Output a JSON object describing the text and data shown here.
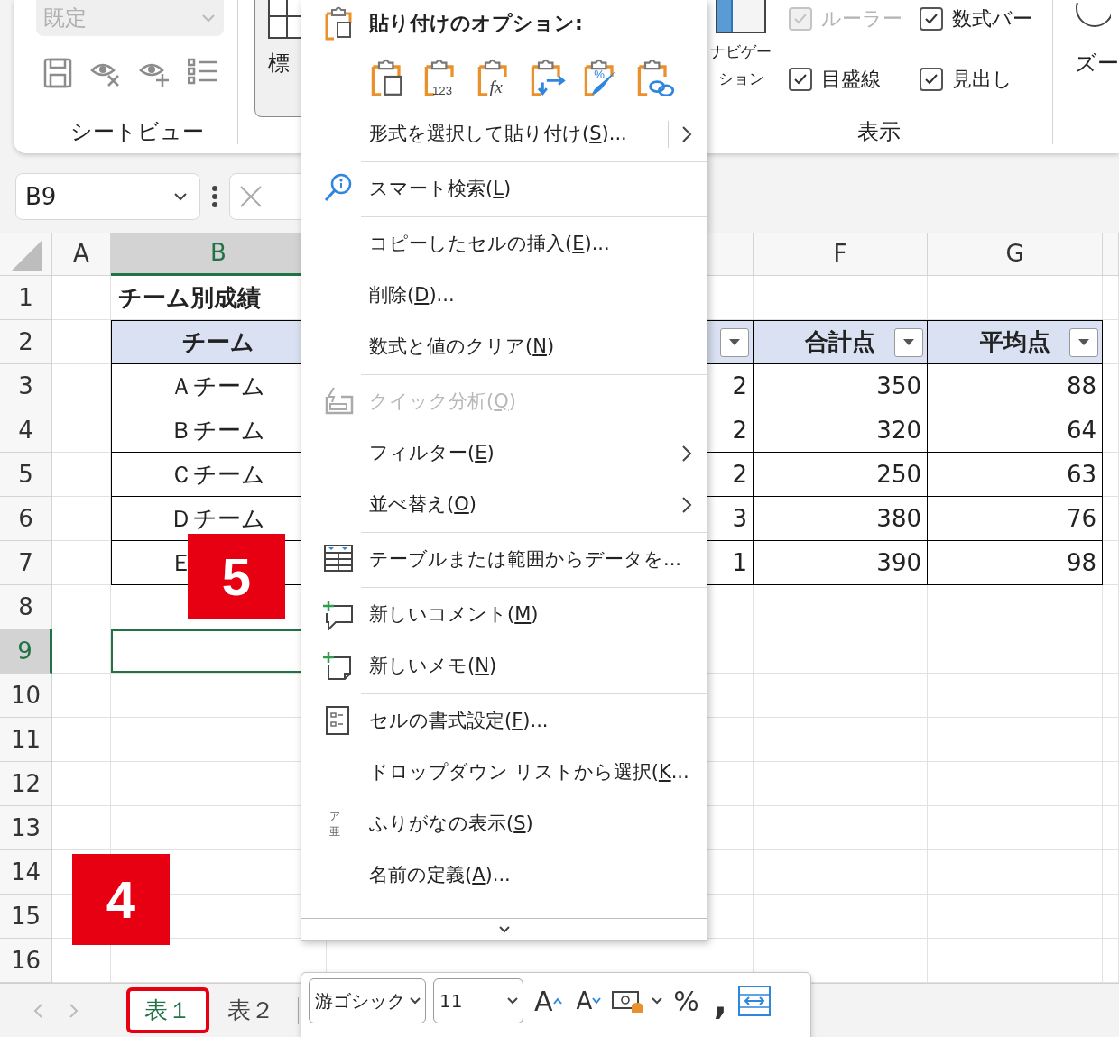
{
  "ribbon": {
    "sheet_view": {
      "dropdown": {
        "value": "既定",
        "disabled": true
      },
      "label": "シートビュー"
    },
    "normal_button": {
      "label": "標"
    },
    "show": {
      "navigation_label": "ナビゲーション",
      "checkboxes": [
        {
          "label": "ルーラー",
          "checked": true,
          "disabled": true
        },
        {
          "label": "数式バー",
          "checked": true,
          "disabled": false
        },
        {
          "label": "目盛線",
          "checked": true,
          "disabled": false
        },
        {
          "label": "見出し",
          "checked": true,
          "disabled": false
        }
      ],
      "label": "表示"
    },
    "zoom": {
      "label": "ズー"
    }
  },
  "formula_bar": {
    "name_box": "B9"
  },
  "sheet": {
    "columns": {
      "A": {
        "label": "A",
        "selected": false
      },
      "B": {
        "label": "B",
        "selected": true
      },
      "F": {
        "label": "F",
        "selected": false
      },
      "G": {
        "label": "G",
        "selected": false
      }
    },
    "rows": [
      {
        "label": "1",
        "selected": false,
        "kind": "title",
        "cells": {
          "B": {
            "text": "チーム別成績"
          }
        }
      },
      {
        "label": "2",
        "selected": false,
        "kind": "table-header",
        "cells": {
          "B": {
            "text": "チーム"
          },
          "E": {
            "filter": true
          },
          "F": {
            "text": "合計点",
            "filter": true
          },
          "G": {
            "text": "平均点",
            "filter": true
          }
        }
      },
      {
        "label": "3",
        "selected": false,
        "kind": "table-row",
        "cells": {
          "B": {
            "text": "Ａチーム"
          },
          "E": {
            "text": "2"
          },
          "F": {
            "text": "350"
          },
          "G": {
            "text": "88"
          }
        }
      },
      {
        "label": "4",
        "selected": false,
        "kind": "table-row",
        "cells": {
          "B": {
            "text": "Ｂチーム"
          },
          "E": {
            "text": "2"
          },
          "F": {
            "text": "320"
          },
          "G": {
            "text": "64"
          }
        }
      },
      {
        "label": "5",
        "selected": false,
        "kind": "table-row",
        "cells": {
          "B": {
            "text": "Ｃチーム"
          },
          "E": {
            "text": "2"
          },
          "F": {
            "text": "250"
          },
          "G": {
            "text": "63"
          }
        }
      },
      {
        "label": "6",
        "selected": false,
        "kind": "table-row",
        "cells": {
          "B": {
            "text": "Ｄチーム"
          },
          "E": {
            "text": "3"
          },
          "F": {
            "text": "380"
          },
          "G": {
            "text": "76"
          }
        }
      },
      {
        "label": "7",
        "selected": false,
        "kind": "table-row",
        "cells": {
          "B": {
            "text": "Ｅ"
          },
          "E": {
            "text": "1"
          },
          "F": {
            "text": "390"
          },
          "G": {
            "text": "98"
          }
        }
      },
      {
        "label": "8",
        "selected": false,
        "kind": "plain"
      },
      {
        "label": "9",
        "selected": true,
        "kind": "plain"
      },
      {
        "label": "10",
        "selected": false,
        "kind": "plain"
      },
      {
        "label": "11",
        "selected": false,
        "kind": "plain"
      },
      {
        "label": "12",
        "selected": false,
        "kind": "plain"
      },
      {
        "label": "13",
        "selected": false,
        "kind": "plain"
      },
      {
        "label": "14",
        "selected": false,
        "kind": "plain"
      },
      {
        "label": "15",
        "selected": false,
        "kind": "plain"
      },
      {
        "label": "16",
        "selected": false,
        "kind": "plain"
      }
    ]
  },
  "sheet_tabs": [
    {
      "label": "表１",
      "selected": true,
      "highlighted": true
    },
    {
      "label": "表２",
      "selected": false,
      "highlighted": false
    }
  ],
  "context_menu": {
    "items": [
      {
        "kind": "header",
        "label": "貼り付けのオプション:"
      },
      {
        "kind": "paste-options",
        "options": [
          {
            "kind": "paste"
          },
          {
            "kind": "values",
            "glyph": "123"
          },
          {
            "kind": "formulas",
            "glyph": "fx"
          },
          {
            "kind": "transpose"
          },
          {
            "kind": "formatting",
            "glyph": "%"
          },
          {
            "kind": "link"
          }
        ]
      },
      {
        "kind": "split-item",
        "before": "形式を選択して貼り付け(",
        "key": "S",
        "after": ")...",
        "disabled": false,
        "submenu": true,
        "separator_after": true
      },
      {
        "kind": "item",
        "before": "スマート検索(",
        "key": "L",
        "after": ")",
        "disabled": false,
        "submenu": false,
        "separator_after": true
      },
      {
        "kind": "item",
        "before": "コピーしたセルの挿入(",
        "key": "E",
        "after": ")...",
        "disabled": false,
        "submenu": false,
        "separator_after": false
      },
      {
        "kind": "item",
        "before": "削除(",
        "key": "D",
        "after": ")...",
        "disabled": false,
        "submenu": false,
        "separator_after": false
      },
      {
        "kind": "item",
        "before": "数式と値のクリア(",
        "key": "N",
        "after": ")",
        "disabled": false,
        "submenu": false,
        "separator_after": true
      },
      {
        "kind": "item",
        "before": "クイック分析(",
        "key": "Q",
        "after": ")",
        "disabled": true,
        "submenu": false,
        "separator_after": false
      },
      {
        "kind": "item",
        "before": "フィルター(",
        "key": "E",
        "after": ")",
        "disabled": false,
        "submenu": true,
        "separator_after": false
      },
      {
        "kind": "item",
        "before": "並べ替え(",
        "key": "O",
        "after": ")",
        "disabled": false,
        "submenu": true,
        "separator_after": true
      },
      {
        "kind": "item",
        "before": "テーブルまたは範囲からデータを...",
        "disabled": false,
        "submenu": false,
        "separator_after": true
      },
      {
        "kind": "item",
        "before": "新しいコメント(",
        "key": "M",
        "after": ")",
        "disabled": false,
        "submenu": false,
        "separator_after": false
      },
      {
        "kind": "item",
        "before": "新しいメモ(",
        "key": "N",
        "after": ")",
        "disabled": false,
        "submenu": false,
        "separator_after": true
      },
      {
        "kind": "item",
        "before": "セルの書式設定(",
        "key": "F",
        "after": ")...",
        "disabled": false,
        "submenu": false,
        "separator_after": false
      },
      {
        "kind": "item",
        "before": "ドロップダウン リストから選択(",
        "key": "K",
        "after": "...",
        "disabled": false,
        "submenu": false,
        "separator_after": false
      },
      {
        "kind": "item",
        "icon_glyph": "ア亜",
        "before": "ふりがなの表示(",
        "key": "S",
        "after": ")",
        "disabled": false,
        "submenu": false,
        "separator_after": false
      },
      {
        "kind": "item",
        "before": "名前の定義(",
        "key": "A",
        "after": ")...",
        "disabled": false,
        "submenu": false,
        "separator_after": false
      }
    ]
  },
  "mini_toolbar": {
    "font": "游ゴシック",
    "size": "11",
    "grow": "A",
    "shrink": "A",
    "percent": "%",
    "comma": ","
  },
  "callouts": [
    {
      "label": "5"
    },
    {
      "label": "4"
    }
  ]
}
